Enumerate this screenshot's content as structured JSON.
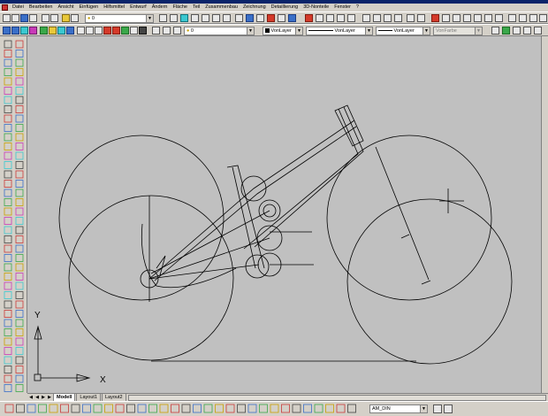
{
  "menu": {
    "items": [
      "Datei",
      "Bearbeiten",
      "Ansicht",
      "Einfügen",
      "Hilfsmittel",
      "Entwurf",
      "Ändern",
      "Fläche",
      "Teil",
      "Zusammenbau",
      "Zeichnung",
      "Detaillierung",
      "3D-Nonteile",
      "Fenster",
      "?"
    ]
  },
  "toolbar1": {
    "layer_value": "0"
  },
  "toolbar2": {
    "layer_value": "0",
    "color_value": "VonLayer",
    "linetype_value": "VonLayer",
    "lineweight_value": "VonLayer",
    "plotstyle_value": "VonFarbe"
  },
  "tabs": {
    "model": "Modell",
    "layout1": "Layout1",
    "layout2": "Layout2"
  },
  "ucs": {
    "x_label": "X",
    "y_label": "Y"
  },
  "snapbar": {
    "dimstyle_value": "AM_DIN"
  },
  "icons": {
    "left_toolbar": [
      "line-icon",
      "xline-icon",
      "polyline-icon",
      "polygon-icon",
      "rectangle-icon",
      "arc-icon",
      "circle-icon",
      "spline-icon",
      "ellipse-icon",
      "insert-block-icon",
      "point-icon",
      "hatch-icon",
      "region-icon",
      "text-icon"
    ]
  }
}
